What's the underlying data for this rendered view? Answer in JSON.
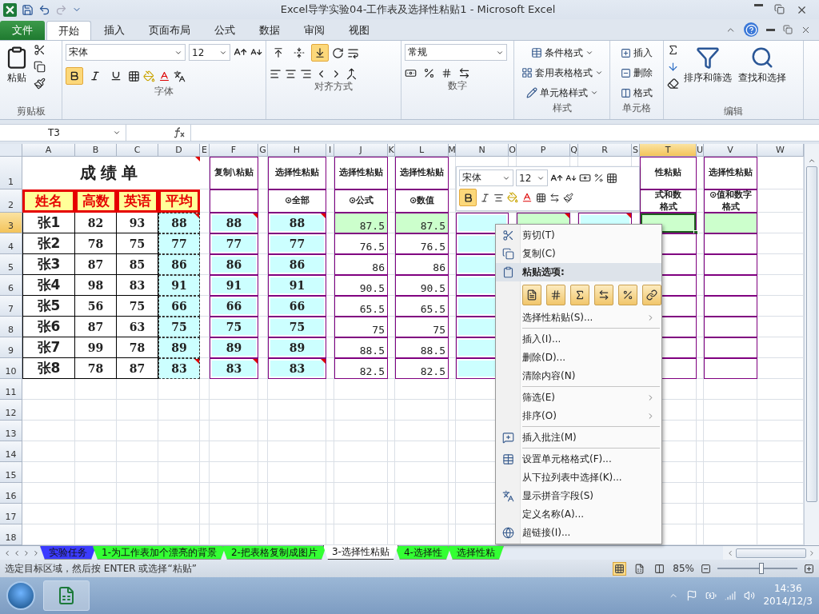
{
  "window": {
    "title": "Excel导学实验04-工作表及选择性粘贴1  -  Microsoft Excel"
  },
  "ribbon": {
    "tabs": [
      {
        "label": "文件",
        "kind": "file",
        "selected": false
      },
      {
        "label": "开始",
        "kind": "tab",
        "selected": true
      },
      {
        "label": "插入",
        "kind": "tab",
        "selected": false
      },
      {
        "label": "页面布局",
        "kind": "tab",
        "selected": false
      },
      {
        "label": "公式",
        "kind": "tab",
        "selected": false
      },
      {
        "label": "数据",
        "kind": "tab",
        "selected": false
      },
      {
        "label": "审阅",
        "kind": "tab",
        "selected": false
      },
      {
        "label": "视图",
        "kind": "tab",
        "selected": false
      }
    ],
    "clipboard": {
      "label": "剪贴板",
      "paste": "粘贴"
    },
    "font": {
      "label": "字体",
      "font_name": "宋体",
      "font_size": "12",
      "toggles": [
        {
          "selected": true
        },
        {
          "selected": false
        },
        {
          "selected": false
        }
      ]
    },
    "alignment": {
      "label": "对齐方式",
      "vertical": [
        {
          "selected": false
        },
        {
          "selected": false
        },
        {
          "selected": true
        }
      ]
    },
    "number": {
      "label": "数字",
      "format": "常规"
    },
    "styles": {
      "label": "样式",
      "items": [
        "条件格式",
        "套用表格格式",
        "单元格样式"
      ]
    },
    "cells": {
      "label": "单元格",
      "items": [
        "插入",
        "删除",
        "格式"
      ]
    },
    "editing": {
      "label": "编辑",
      "buttons": [
        "排序和筛选",
        "查找和选择"
      ]
    }
  },
  "formula_bar": {
    "name_box": "T3"
  },
  "sheet": {
    "columns": [
      {
        "label": "A",
        "selected": false
      },
      {
        "label": "B",
        "selected": false
      },
      {
        "label": "C",
        "selected": false
      },
      {
        "label": "D",
        "selected": false
      },
      {
        "label": "E",
        "selected": false
      },
      {
        "label": "F",
        "selected": false
      },
      {
        "label": "G",
        "selected": false
      },
      {
        "label": "H",
        "selected": false
      },
      {
        "label": "I",
        "selected": false
      },
      {
        "label": "J",
        "selected": false
      },
      {
        "label": "K",
        "selected": false
      },
      {
        "label": "L",
        "selected": false
      },
      {
        "label": "M",
        "selected": false
      },
      {
        "label": "N",
        "selected": false
      },
      {
        "label": "O",
        "selected": false
      },
      {
        "label": "P",
        "selected": false
      },
      {
        "label": "Q",
        "selected": false
      },
      {
        "label": "R",
        "selected": false
      },
      {
        "label": "S",
        "selected": false
      },
      {
        "label": "T",
        "selected": true
      },
      {
        "label": "U",
        "selected": false
      },
      {
        "label": "V",
        "selected": false
      },
      {
        "label": "W",
        "selected": false
      }
    ],
    "rows": [
      {
        "label": "1",
        "selected": false,
        "cells": {
          "A": {
            "kind": "title",
            "text": "成绩单",
            "comment": true
          },
          "F": {
            "kind": "label",
            "text": "复制\\粘贴"
          },
          "H": {
            "kind": "label",
            "text": "选择性粘贴"
          },
          "J": {
            "kind": "label",
            "text": "选择性粘贴"
          },
          "L": {
            "kind": "label",
            "text": "选择性粘贴"
          },
          "T": {
            "kind": "label",
            "text": "性粘贴"
          },
          "V": {
            "kind": "label",
            "text": "选择性粘贴"
          }
        }
      },
      {
        "label": "2",
        "selected": false,
        "cells": {
          "A": {
            "kind": "header",
            "text": "姓名"
          },
          "B": {
            "kind": "header",
            "text": "高数"
          },
          "C": {
            "kind": "header",
            "text": "英语"
          },
          "D": {
            "kind": "header",
            "text": "平均"
          },
          "F": {
            "kind": "frame"
          },
          "H": {
            "kind": "label",
            "text": "⊙全部"
          },
          "J": {
            "kind": "label",
            "text": "⊙公式"
          },
          "L": {
            "kind": "label",
            "text": "⊙数值"
          },
          "T": {
            "kind": "label",
            "lines": [
              "式和数",
              "格式"
            ]
          },
          "V": {
            "kind": "label",
            "lines": [
              "⊙值和数字",
              "格式"
            ]
          }
        }
      },
      {
        "label": "3",
        "selected": true,
        "cells": {
          "A": {
            "kind": "name",
            "text": "张1"
          },
          "B": {
            "kind": "score",
            "text": "82"
          },
          "C": {
            "kind": "score",
            "text": "93"
          },
          "D": {
            "kind": "avg",
            "text": "88",
            "comment": true
          },
          "F": {
            "kind": "pasted",
            "text": "88",
            "comment": true
          },
          "H": {
            "kind": "pasted",
            "text": "88",
            "comment": true
          },
          "J": {
            "kind": "value",
            "text": "87.5",
            "highlight": true
          },
          "L": {
            "kind": "value",
            "text": "87.5",
            "highlight": true
          },
          "N": {
            "kind": "pasted"
          },
          "P": {
            "kind": "frame",
            "highlight": true,
            "comment": true
          },
          "R": {
            "kind": "pasted",
            "comment": true
          },
          "T": {
            "kind": "frame",
            "highlight": true,
            "selected": true
          },
          "V": {
            "kind": "frame",
            "highlight": true
          }
        }
      },
      {
        "label": "4",
        "selected": false,
        "cells": {
          "A": {
            "kind": "name",
            "text": "张2"
          },
          "B": {
            "kind": "score",
            "text": "78"
          },
          "C": {
            "kind": "score",
            "text": "75"
          },
          "D": {
            "kind": "avg",
            "text": "77"
          },
          "F": {
            "kind": "pasted",
            "text": "77"
          },
          "H": {
            "kind": "pasted",
            "text": "77"
          },
          "J": {
            "kind": "value",
            "text": "76.5"
          },
          "L": {
            "kind": "value",
            "text": "76.5"
          },
          "N": {
            "kind": "pasted"
          },
          "T": {
            "kind": "frame"
          },
          "V": {
            "kind": "frame"
          }
        }
      },
      {
        "label": "5",
        "selected": false,
        "cells": {
          "A": {
            "kind": "name",
            "text": "张3"
          },
          "B": {
            "kind": "score",
            "text": "87"
          },
          "C": {
            "kind": "score",
            "text": "85"
          },
          "D": {
            "kind": "avg",
            "text": "86"
          },
          "F": {
            "kind": "pasted",
            "text": "86"
          },
          "H": {
            "kind": "pasted",
            "text": "86"
          },
          "J": {
            "kind": "value",
            "text": "86"
          },
          "L": {
            "kind": "value",
            "text": "86"
          },
          "N": {
            "kind": "pasted"
          },
          "T": {
            "kind": "frame"
          },
          "V": {
            "kind": "frame"
          }
        }
      },
      {
        "label": "6",
        "selected": false,
        "cells": {
          "A": {
            "kind": "name",
            "text": "张4"
          },
          "B": {
            "kind": "score",
            "text": "98"
          },
          "C": {
            "kind": "score",
            "text": "83"
          },
          "D": {
            "kind": "avg",
            "text": "91"
          },
          "F": {
            "kind": "pasted",
            "text": "91"
          },
          "H": {
            "kind": "pasted",
            "text": "91"
          },
          "J": {
            "kind": "value",
            "text": "90.5"
          },
          "L": {
            "kind": "value",
            "text": "90.5"
          },
          "N": {
            "kind": "pasted"
          },
          "T": {
            "kind": "frame"
          },
          "V": {
            "kind": "frame"
          }
        }
      },
      {
        "label": "7",
        "selected": false,
        "cells": {
          "A": {
            "kind": "name",
            "text": "张5"
          },
          "B": {
            "kind": "score",
            "text": "56"
          },
          "C": {
            "kind": "score",
            "text": "75"
          },
          "D": {
            "kind": "avg",
            "text": "66"
          },
          "F": {
            "kind": "pasted",
            "text": "66"
          },
          "H": {
            "kind": "pasted",
            "text": "66"
          },
          "J": {
            "kind": "value",
            "text": "65.5"
          },
          "L": {
            "kind": "value",
            "text": "65.5"
          },
          "N": {
            "kind": "pasted"
          },
          "T": {
            "kind": "frame"
          },
          "V": {
            "kind": "frame"
          }
        }
      },
      {
        "label": "8",
        "selected": false,
        "cells": {
          "A": {
            "kind": "name",
            "text": "张6"
          },
          "B": {
            "kind": "score",
            "text": "87"
          },
          "C": {
            "kind": "score",
            "text": "63"
          },
          "D": {
            "kind": "avg",
            "text": "75"
          },
          "F": {
            "kind": "pasted",
            "text": "75"
          },
          "H": {
            "kind": "pasted",
            "text": "75"
          },
          "J": {
            "kind": "value",
            "text": "75"
          },
          "L": {
            "kind": "value",
            "text": "75"
          },
          "N": {
            "kind": "pasted"
          },
          "T": {
            "kind": "frame"
          },
          "V": {
            "kind": "frame"
          }
        }
      },
      {
        "label": "9",
        "selected": false,
        "cells": {
          "A": {
            "kind": "name",
            "text": "张7"
          },
          "B": {
            "kind": "score",
            "text": "99"
          },
          "C": {
            "kind": "score",
            "text": "78"
          },
          "D": {
            "kind": "avg",
            "text": "89"
          },
          "F": {
            "kind": "pasted",
            "text": "89"
          },
          "H": {
            "kind": "pasted",
            "text": "89"
          },
          "J": {
            "kind": "value",
            "text": "88.5"
          },
          "L": {
            "kind": "value",
            "text": "88.5"
          },
          "N": {
            "kind": "pasted"
          },
          "T": {
            "kind": "frame"
          },
          "V": {
            "kind": "frame"
          }
        }
      },
      {
        "label": "10",
        "selected": false,
        "cells": {
          "A": {
            "kind": "name",
            "text": "张8"
          },
          "B": {
            "kind": "score",
            "text": "78"
          },
          "C": {
            "kind": "score",
            "text": "87"
          },
          "D": {
            "kind": "avg",
            "text": "83",
            "comment": true
          },
          "F": {
            "kind": "pasted",
            "text": "83",
            "comment": true
          },
          "H": {
            "kind": "pasted",
            "text": "83",
            "comment": true
          },
          "J": {
            "kind": "value",
            "text": "82.5"
          },
          "L": {
            "kind": "value",
            "text": "82.5"
          },
          "N": {
            "kind": "pasted"
          },
          "T": {
            "kind": "frame"
          },
          "V": {
            "kind": "frame"
          }
        }
      },
      {
        "label": "11",
        "selected": false
      },
      {
        "label": "12",
        "selected": false
      },
      {
        "label": "13",
        "selected": false
      },
      {
        "label": "14",
        "selected": false
      },
      {
        "label": "15",
        "selected": false
      },
      {
        "label": "16",
        "selected": false
      },
      {
        "label": "17",
        "selected": false
      },
      {
        "label": "18",
        "selected": false
      }
    ]
  },
  "mini_toolbar": {
    "font_name": "宋体",
    "font_size": "12",
    "bold": true
  },
  "context_menu": {
    "items": [
      {
        "kind": "cut",
        "label": "剪切(T)"
      },
      {
        "kind": "copy",
        "label": "复制(C)"
      },
      {
        "kind": "paste",
        "label": "粘贴选项:"
      },
      {
        "kind": "options"
      },
      {
        "kind": "plain",
        "label": "选择性粘贴(S)...",
        "submenu": true
      },
      {
        "kind": "plain",
        "label": "插入(I)...",
        "separator_before": true
      },
      {
        "kind": "plain",
        "label": "删除(D)..."
      },
      {
        "kind": "plain",
        "label": "清除内容(N)"
      },
      {
        "kind": "plain",
        "label": "筛选(E)",
        "submenu": true,
        "separator_before": true
      },
      {
        "kind": "plain",
        "label": "排序(O)",
        "submenu": true
      },
      {
        "kind": "comment",
        "label": "插入批注(M)",
        "separator_before": true
      },
      {
        "kind": "format",
        "label": "设置单元格格式(F)...",
        "separator_before": true
      },
      {
        "kind": "plain",
        "label": "从下拉列表中选择(K)..."
      },
      {
        "kind": "phonetic",
        "label": "显示拼音字段(S)"
      },
      {
        "kind": "plain",
        "label": "定义名称(A)..."
      },
      {
        "kind": "link",
        "label": "超链接(I)..."
      }
    ]
  },
  "sheet_tabs": [
    {
      "label": "实验任务",
      "color": "#3b3bff",
      "selected": false
    },
    {
      "label": "1-为工作表加个漂亮的背景",
      "color": "#33ff33",
      "selected": false
    },
    {
      "label": "2-把表格复制成图片",
      "color": "#33ff33",
      "selected": false
    },
    {
      "label": "3-选择性粘贴",
      "color": "#ffffff",
      "selected": true
    },
    {
      "label": "4-选择性",
      "color": "#33ff33",
      "selected": false
    },
    {
      "label": "选择性粘",
      "color": "#33ff33",
      "selected": false
    }
  ],
  "status_bar": {
    "message": "选定目标区域，然后按 ENTER 或选择“粘贴”",
    "views": [
      {
        "selected": true
      },
      {
        "selected": false
      },
      {
        "selected": false
      }
    ],
    "zoom": "85%",
    "zoom_slider": {
      "level": 0.55
    }
  },
  "taskbar": {
    "time": "14:36",
    "date": "2014/12/3"
  }
}
